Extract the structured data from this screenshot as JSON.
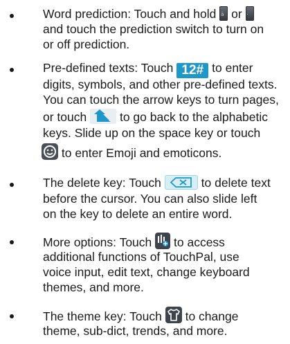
{
  "items": [
    {
      "lines": [
        {
          "t1": "Word prediction: Touch and hold ",
          "t2": " or ",
          "t3": ""
        },
        {
          "t1": "and touch the prediction switch to turn on"
        },
        {
          "t1": "or off prediction."
        }
      ],
      "icons": [
        "key-left-icon",
        "key-right-icon"
      ]
    },
    {
      "lines": [
        {
          "t1": "Pre-defined texts: Touch ",
          "key": "12#",
          "t2": " to enter"
        },
        {
          "t1": "digits, symbols, and other pre-defined texts."
        },
        {
          "t1": "You can touch the arrow keys to turn pages,"
        },
        {
          "t1": "or touch ",
          "t2": " to go back to the alphabetic"
        },
        {
          "t1": "keys. Slide up on the space key or touch"
        },
        {
          "t1": " to enter Emoji and emoticons."
        }
      ],
      "icons": [
        "back-arrow-icon",
        "emoji-icon"
      ]
    },
    {
      "lines": [
        {
          "t1": "The delete key: Touch ",
          "t2": " to delete text"
        },
        {
          "t1": "before the cursor. You can also slide left"
        },
        {
          "t1": "on the key to delete an entire word."
        }
      ],
      "icons": [
        "delete-key-icon"
      ]
    },
    {
      "lines": [
        {
          "t1": "More options: Touch ",
          "t2": " to access"
        },
        {
          "t1": "additional functions of TouchPal, use"
        },
        {
          "t1": "voice input, edit text, change keyboard"
        },
        {
          "t1": "themes, and more."
        }
      ],
      "icons": [
        "more-options-icon"
      ]
    },
    {
      "lines": [
        {
          "t1": "The theme key: Touch ",
          "t2": " to change"
        },
        {
          "t1": "theme, sub-dict, trends, and more."
        }
      ],
      "icons": [
        "theme-shirt-icon"
      ]
    }
  ],
  "colors": {
    "text": "#1a1a1a",
    "accent_blue": "#1e98c8"
  }
}
